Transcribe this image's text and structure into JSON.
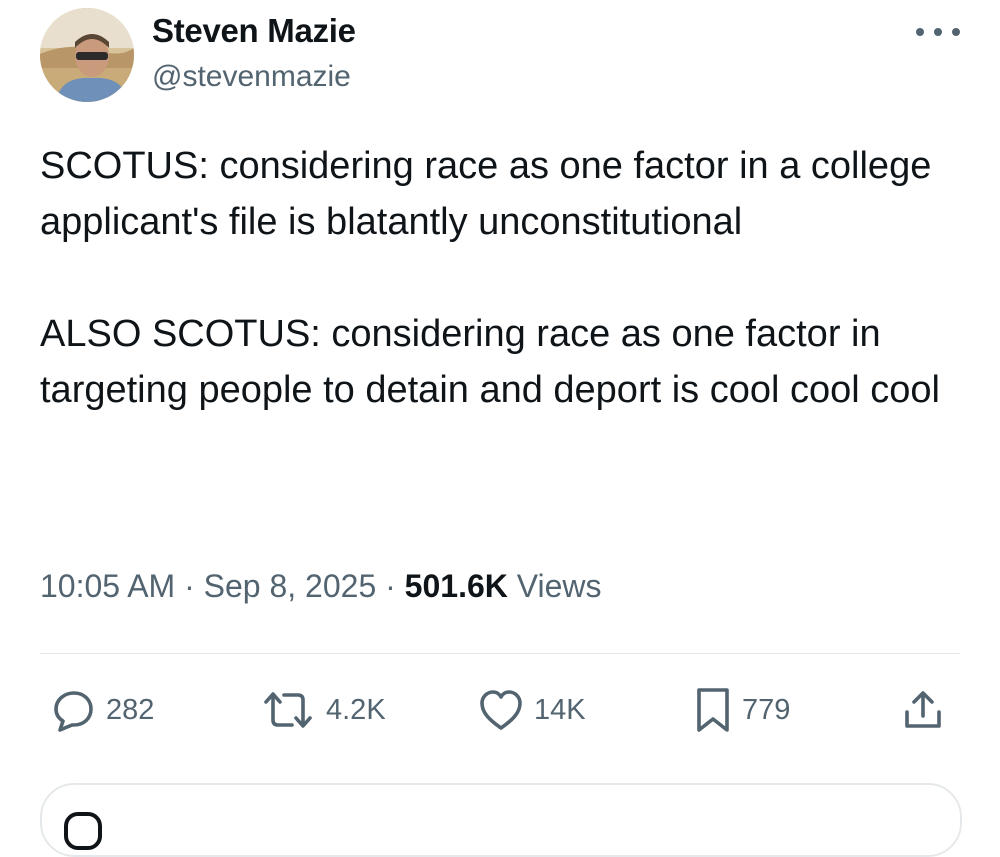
{
  "author": {
    "name": "Steven Mazie",
    "handle": "@stevenmazie"
  },
  "tweet": {
    "paragraph1": "SCOTUS: considering race as one factor in a college applicant's file is blatantly unconstitutional",
    "paragraph2": "ALSO SCOTUS: considering race as one factor in targeting people to detain and deport is cool cool cool"
  },
  "meta": {
    "time": "10:05 AM",
    "separator": "·",
    "date": "Sep 8, 2025",
    "views_count": "501.6K",
    "views_label": "Views"
  },
  "actions": {
    "replies": "282",
    "reposts": "4.2K",
    "likes": "14K",
    "bookmarks": "779"
  },
  "icons": {
    "more": "more-horizontal-icon",
    "reply": "reply-icon",
    "repost": "repost-icon",
    "like": "heart-icon",
    "bookmark": "bookmark-icon",
    "share": "share-icon"
  },
  "colors": {
    "text_primary": "#0f1419",
    "text_secondary": "#536471",
    "divider": "#e6e9eb"
  }
}
